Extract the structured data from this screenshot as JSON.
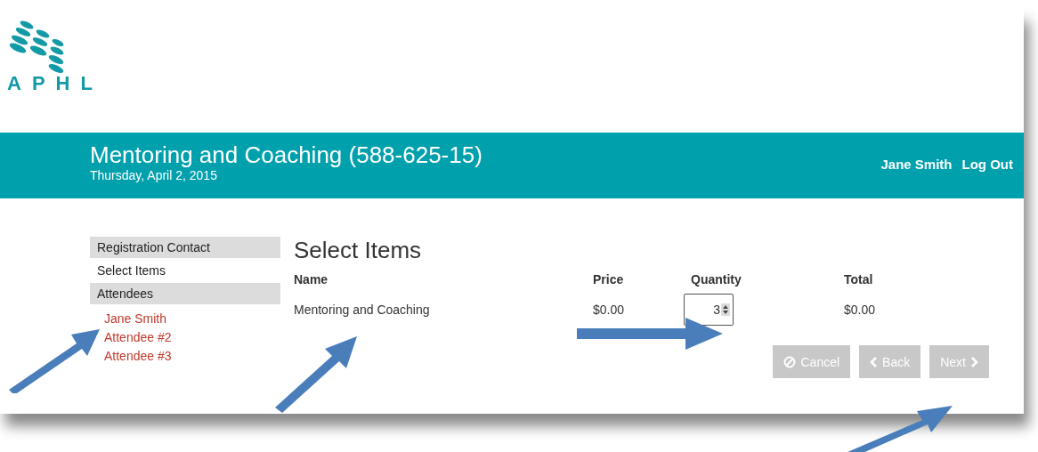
{
  "logo": {
    "text": "APHL"
  },
  "header": {
    "title": "Mentoring and Coaching (588-625-15)",
    "date": "Thursday, April 2, 2015",
    "user": "Jane Smith",
    "logout": "Log Out"
  },
  "sidebar": {
    "items": [
      {
        "label": "Registration Contact",
        "selected": false
      },
      {
        "label": "Select Items",
        "selected": true
      },
      {
        "label": "Attendees",
        "selected": false,
        "children": [
          {
            "label": "Jane Smith"
          },
          {
            "label": "Attendee #2"
          },
          {
            "label": "Attendee #3"
          }
        ]
      }
    ]
  },
  "main": {
    "heading": "Select Items",
    "table": {
      "columns": [
        "Name",
        "Price",
        "Quantity",
        "Total"
      ],
      "rows": [
        {
          "name": "Mentoring and Coaching",
          "price": "$0.00",
          "quantity": "3",
          "total": "$0.00"
        }
      ]
    }
  },
  "buttons": [
    {
      "label": "Cancel",
      "kind": "cancel",
      "disabled": true
    },
    {
      "label": "Back",
      "kind": "back",
      "disabled": true
    },
    {
      "label": "Next",
      "kind": "next",
      "disabled": true
    }
  ]
}
